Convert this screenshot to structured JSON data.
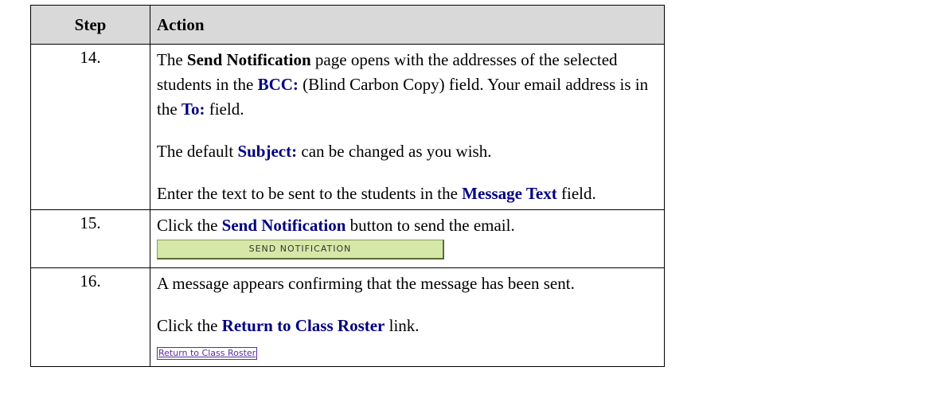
{
  "table": {
    "header_step": "Step",
    "header_action": "Action"
  },
  "rows": [
    {
      "step": "14.",
      "p1": {
        "t1": "The ",
        "b1": "Send Notification",
        "t2": " page opens with the addresses of the selected students in the ",
        "b2": "BCC:",
        "t3": " (Blind Carbon Copy) field.  Your email address is in the ",
        "b3": "To:",
        "t4": " field."
      },
      "p2": {
        "t1": "The default ",
        "b1": "Subject:",
        "t2": " can be changed as you wish."
      },
      "p3": {
        "t1": "Enter the text to be sent to the students in the ",
        "b1": "Message Text",
        "t2": " field."
      }
    },
    {
      "step": "15.",
      "p1": {
        "t1": "Click the ",
        "b1": "Send Notification",
        "t2": " button to send the email."
      },
      "button_label": "SEND NOTIFICATION"
    },
    {
      "step": "16.",
      "p1": {
        "t1": "A message appears confirming that the message has been sent."
      },
      "p2": {
        "t1": "Click the ",
        "b1": "Return to Class Roster",
        "t2": " link."
      },
      "link_label": "Return to Class Roster"
    }
  ]
}
